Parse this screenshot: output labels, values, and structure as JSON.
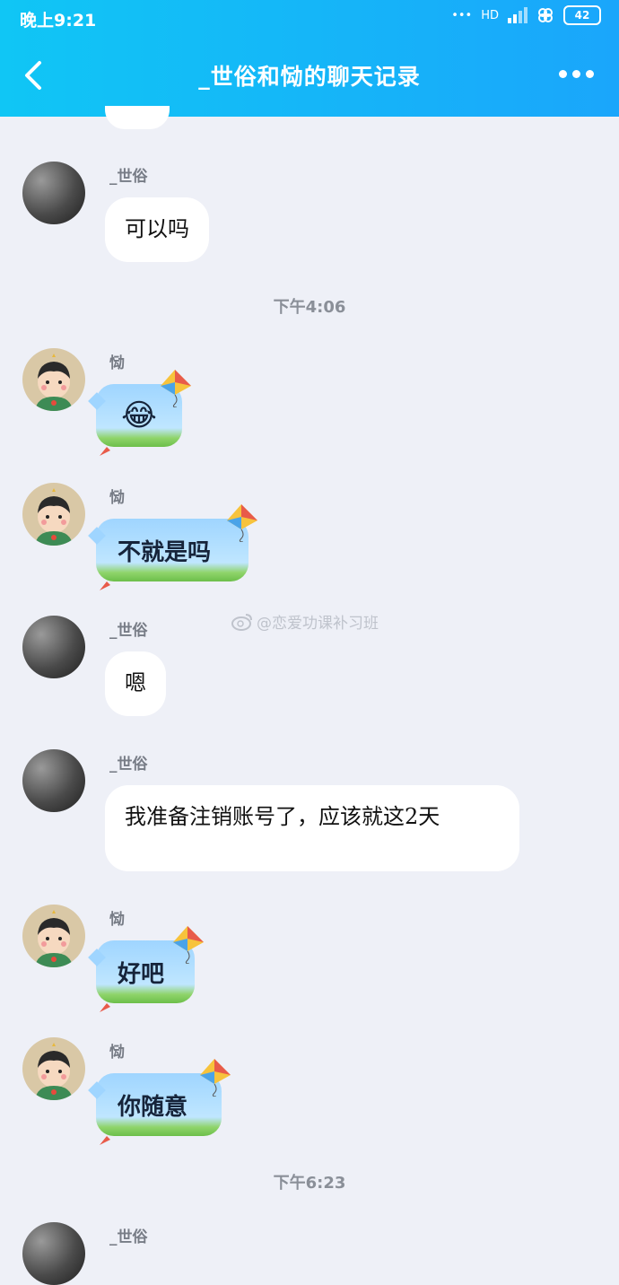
{
  "status_bar": {
    "time": "晚上9:21",
    "network": "HD",
    "battery": "42"
  },
  "header": {
    "title": "_世俗和恸的聊天记录"
  },
  "messages": [
    {
      "sender": "_世俗",
      "text": "可以吗"
    },
    {
      "sender": "恸",
      "text": "😂"
    },
    {
      "sender": "恸",
      "text": "不就是吗"
    },
    {
      "sender": "_世俗",
      "text": "嗯"
    },
    {
      "sender": "_世俗",
      "text": "我准备注销账号了，应该就这2天"
    },
    {
      "sender": "恸",
      "text": "好吧"
    },
    {
      "sender": "恸",
      "text": "你随意"
    },
    {
      "sender": "_世俗",
      "text": ""
    }
  ],
  "timestamps": [
    "下午4:06",
    "下午6:23"
  ],
  "watermark": "@恋爱功课补习班",
  "colors": {
    "header_start": "#10c6f5",
    "header_end": "#1aa6fb",
    "background": "#eef0f7"
  }
}
